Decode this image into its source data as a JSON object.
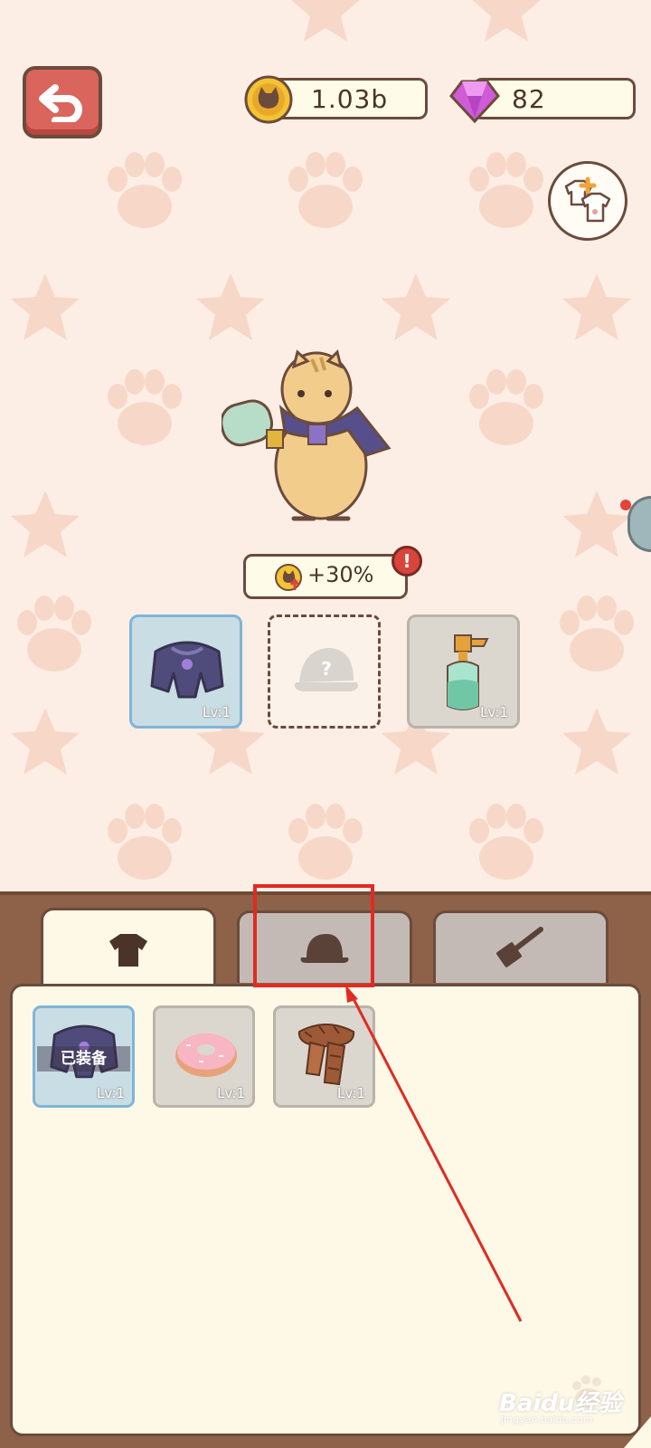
{
  "header": {
    "coins": "1.03b",
    "gems": "82"
  },
  "icons": {
    "back": "back-arrow-icon",
    "coin": "cat-coin-icon",
    "gem": "purple-gem-icon",
    "wardrobe": "wardrobe-add-icon"
  },
  "pet": {
    "bonus": "+30%",
    "alert": "!"
  },
  "equip_slots": [
    {
      "name": "jacket",
      "lv": "Lv:1",
      "state": "equipped"
    },
    {
      "name": "hat",
      "lv": "?",
      "state": "empty"
    },
    {
      "name": "spray-bottle",
      "lv": "Lv:1",
      "state": "filled"
    }
  ],
  "tabs": [
    {
      "name": "clothes",
      "icon": "shirt-icon",
      "active": true
    },
    {
      "name": "hats",
      "icon": "cap-icon",
      "active": false
    },
    {
      "name": "tools",
      "icon": "spatula-icon",
      "active": false
    }
  ],
  "inventory": [
    {
      "name": "jacket",
      "lv": "Lv:1",
      "badge": "已装备"
    },
    {
      "name": "donut",
      "lv": "Lv:1",
      "badge": ""
    },
    {
      "name": "scarf",
      "lv": "Lv:1",
      "badge": ""
    }
  ],
  "watermark": {
    "text": "Baidu经验",
    "url": "jingyan.baidu.com"
  },
  "colors": {
    "background": "#fdeee5",
    "panel": "#8d6248",
    "outline": "#6b4b3c",
    "back_button": "#d9655c",
    "highlight": "#e02b22"
  }
}
